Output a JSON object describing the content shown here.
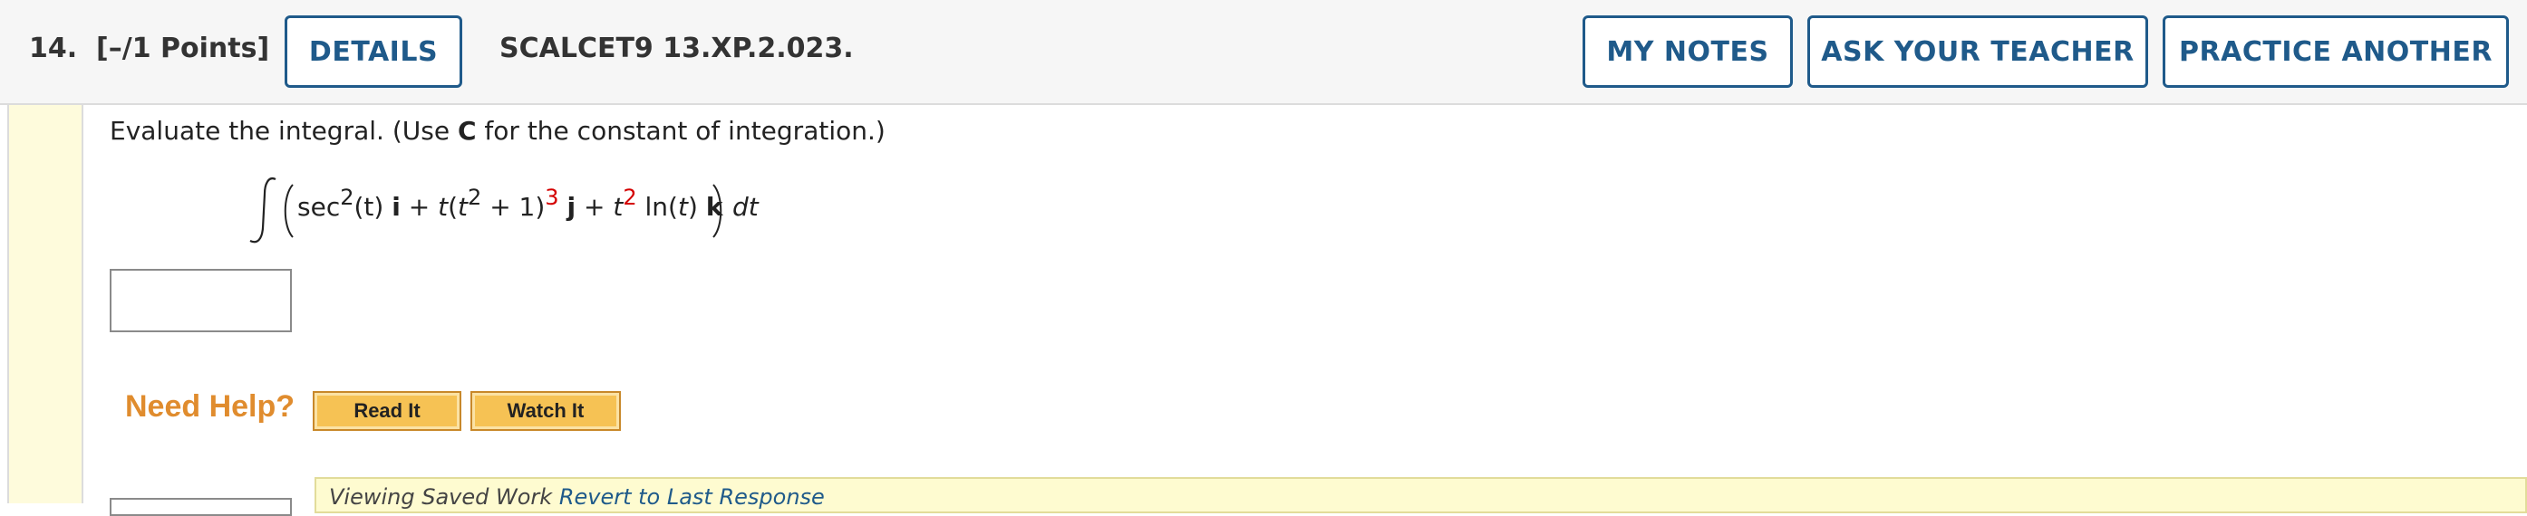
{
  "header": {
    "question_number": "14.",
    "points": "[–/1 Points]",
    "details_label": "DETAILS",
    "question_code": "SCALCET9 13.XP.2.023.",
    "my_notes_label": "MY NOTES",
    "ask_teacher_label": "ASK YOUR TEACHER",
    "practice_another_label": "PRACTICE ANOTHER"
  },
  "question": {
    "prompt_before": "Evaluate the integral. (Use ",
    "prompt_bold": "C",
    "prompt_after": " for the constant of integration.)",
    "formula": {
      "sec": "sec",
      "sec_exp": "2",
      "sec_arg": "(t)",
      "i": "i",
      "plus1": " + ",
      "t1": "t",
      "open": "(",
      "t2": "t",
      "t2_exp": "2",
      "plus_one": " + 1)",
      "outer_exp": "3",
      "j": "j",
      "plus2": " + ",
      "t3": "t",
      "t3_exp": "2",
      "ln": " ln(",
      "t4": "t",
      "ln_close": ")",
      "k": "k",
      "dt": "dt"
    },
    "answer_value": ""
  },
  "help": {
    "label": "Need Help?",
    "read_it": "Read It",
    "watch_it": "Watch It"
  },
  "saved_work": {
    "text": "Viewing Saved Work ",
    "link": "Revert to Last Response"
  },
  "colors": {
    "accent_blue": "#1f5a8a",
    "help_orange": "#e08c2e",
    "exponent_red": "#d40000",
    "rail_yellow": "#fefbdc"
  }
}
